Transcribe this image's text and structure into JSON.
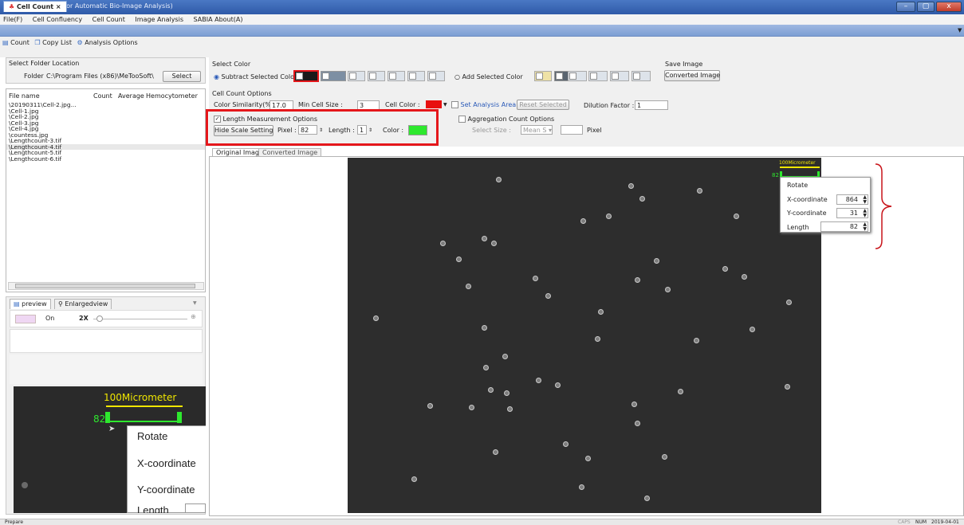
{
  "window": {
    "title": "SABIA(Solution for Automatic Bio-Image Analysis)",
    "buttons": [
      "–",
      "▢",
      "x"
    ]
  },
  "menu": [
    "File(F)",
    "Cell Confluency",
    "Cell Count",
    "Image Analysis",
    "SABIA About(A)"
  ],
  "doc_tab": "Cell Count ×",
  "toolbar": {
    "count": "Count",
    "copy_list": "Copy List",
    "analysis_options": "Analysis Options"
  },
  "folder": {
    "section": "Select Folder Location",
    "label": "Folder",
    "path": "C:\\Program Files (x86)\\MeTooSoft\\",
    "select_button": "Select"
  },
  "file_list": {
    "headers": [
      "File name",
      "Count",
      "Average",
      "Hemocytometer"
    ],
    "items": [
      "\\20190311\\Cell-2.jpg...",
      "\\Cell-1.jpg",
      "\\Cell-2.jpg",
      "\\Cell-3.jpg",
      "\\Cell-4.jpg",
      "\\countess.jpg",
      "\\Lengthcount-3.tif",
      "\\Lengthcount-4.tif",
      "\\Lengthcount-5.tif",
      "\\Lengthcount-6.tif"
    ],
    "selected_index": 7
  },
  "preview": {
    "tabs": [
      "preview",
      "Enlargedview"
    ],
    "toggle_label": "On",
    "zoom": "2X",
    "thumb_scale_label": "100Micrometer",
    "thumb_pixel": "82",
    "thumb_menu": [
      "Rotate",
      "X-coordinate",
      "Y-coordinate",
      "Length"
    ]
  },
  "select_color": {
    "section": "Select Color",
    "subtract_label": "Subtract Selected Color",
    "add_label": "Add Selected Color",
    "save_section": "Save Image",
    "converted_button": "Converted Image"
  },
  "cell_count": {
    "section": "Cell Count Options",
    "similarity_label": "Color Similarity(%) :",
    "similarity": "17.0",
    "min_size_label": "Min Cell Size :",
    "min_size": "3",
    "cell_color_label": "Cell Color :",
    "cell_color": "#e81010",
    "set_area": "Set Analysis Area",
    "reset": "Reset Selected",
    "dilution_label": "Dilution Factor :",
    "dilution": "1"
  },
  "length_options": {
    "checkbox_label": "Length Measurement Options",
    "hide_button": "Hide Scale Setting",
    "pixel_label": "Pixel :",
    "pixel": "82",
    "length_label": "Length :",
    "length": "1",
    "color_label": "Color :",
    "color": "#2ee82e"
  },
  "aggregation": {
    "checkbox_label": "Aggregation Count Options",
    "select_size_label": "Select Size :",
    "mode": "Mean S",
    "pixel_label": "Pixel"
  },
  "image_tabs": [
    "Original Image",
    "Converted Image"
  ],
  "overlay": {
    "scale_label": "100Micrometer",
    "pixel_label": "82",
    "menu_title": "Rotate",
    "x_label": "X-coordinate",
    "x_value": "864",
    "y_label": "Y-coordinate",
    "y_value": "31",
    "len_label": "Length",
    "len_value": "82"
  },
  "status": {
    "left": "Prepare",
    "caps": "CAPS",
    "num": "NUM",
    "date": "2019-04-01"
  },
  "colors": {
    "highlight": "#e5171b",
    "scale_yellow": "#f0e600",
    "scale_green": "#2ee82e",
    "bracket": "#c8141a"
  }
}
